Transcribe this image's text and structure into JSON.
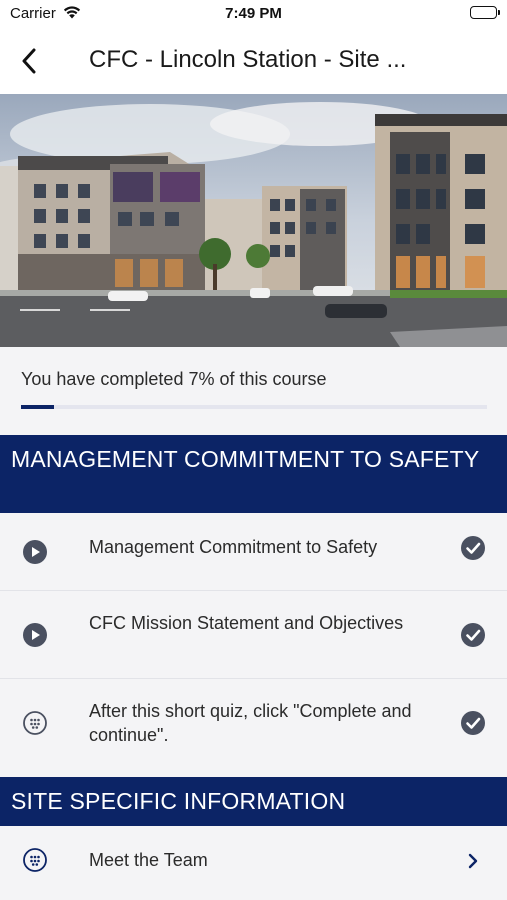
{
  "status_bar": {
    "carrier": "Carrier",
    "time": "7:49 PM"
  },
  "nav": {
    "title": "CFC - Lincoln Station - Site ..."
  },
  "progress": {
    "text": "You have completed 7% of this course",
    "percent": 7
  },
  "sections": [
    {
      "title": "MANAGEMENT COMMITMENT TO SAFETY",
      "lessons": [
        {
          "label": "Management Commitment to Safety",
          "type_icon": "play-icon",
          "status_icon": "check-circle-icon"
        },
        {
          "label": "CFC Mission Statement and Objectives",
          "type_icon": "play-icon",
          "status_icon": "check-circle-icon"
        },
        {
          "label": "After this short quiz, click \"Complete and continue\".",
          "type_icon": "quiz-icon",
          "status_icon": "check-circle-icon"
        }
      ]
    },
    {
      "title": "SITE SPECIFIC INFORMATION",
      "lessons": [
        {
          "label": "Meet the Team",
          "type_icon": "quiz-icon",
          "status_icon": "chevron-right-icon"
        }
      ]
    }
  ],
  "colors": {
    "brand_navy": "#0c2466",
    "icon_gray": "#4a5060",
    "row_bg": "#f4f4f6"
  }
}
